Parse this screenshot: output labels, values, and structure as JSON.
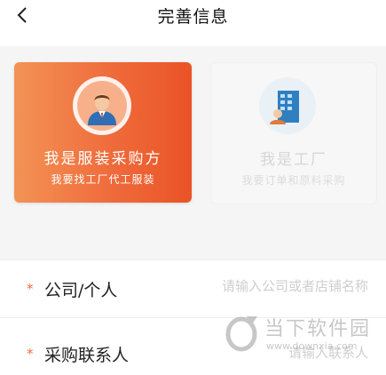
{
  "header": {
    "title": "完善信息",
    "back_icon": "chevron-left-icon"
  },
  "role_cards": {
    "buyer": {
      "title": "我是服装采购方",
      "subtitle": "我要找工厂代工服装",
      "icon": "businessman-avatar-icon",
      "selected": true
    },
    "factory": {
      "title": "我是工厂",
      "subtitle": "我要订单和原料采购",
      "icon": "factory-building-icon",
      "selected": false
    }
  },
  "form": {
    "company": {
      "required_mark": "*",
      "label": "公司/个人",
      "placeholder": "请输入公司或者店铺名称"
    },
    "contact": {
      "required_mark": "*",
      "label": "采购联系人",
      "placeholder": "请输入联系人"
    }
  },
  "watermark": {
    "title": "当下软件园",
    "url": "www.downxia.com"
  },
  "colors": {
    "accent": "#ef6b3b",
    "required": "#f56b3a"
  }
}
